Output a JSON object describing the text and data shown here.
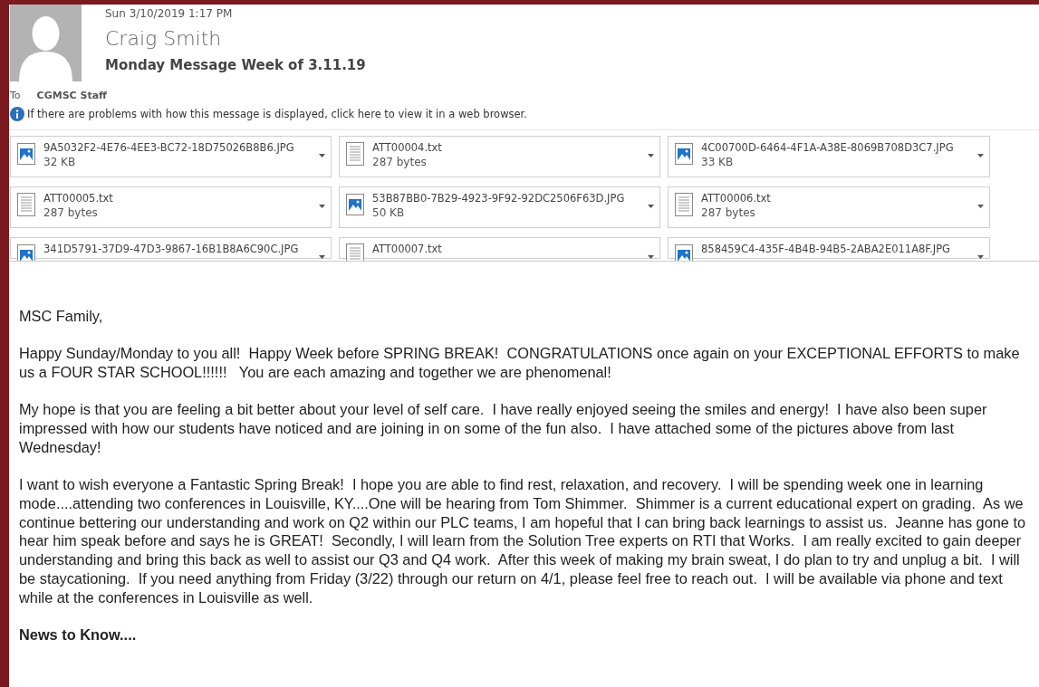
{
  "message": {
    "date": "Sun 3/10/2019 1:17 PM",
    "sender": "Craig Smith",
    "subject": "Monday Message Week of 3.11.19",
    "to_label": "To",
    "to": "CGMSC Staff",
    "info": "If there are problems with how this message is displayed, click here to view it in a web browser."
  },
  "attachments": [
    {
      "kind": "image",
      "name": "9A5032F2-4E76-4EE3-BC72-18D75026B8B6.JPG",
      "size": "32 KB"
    },
    {
      "kind": "text",
      "name": "ATT00004.txt",
      "size": "287 bytes"
    },
    {
      "kind": "image",
      "name": "4C00700D-6464-4F1A-A38E-8069B708D3C7.JPG",
      "size": "33 KB"
    },
    {
      "kind": "text",
      "name": "ATT00005.txt",
      "size": "287 bytes"
    },
    {
      "kind": "image",
      "name": "53B87BB0-7B29-4923-9F92-92DC2506F63D.JPG",
      "size": "50 KB"
    },
    {
      "kind": "text",
      "name": "ATT00006.txt",
      "size": "287 bytes"
    },
    {
      "kind": "image",
      "name": "341D5791-37D9-47D3-9867-16B1B8A6C90C.JPG"
    },
    {
      "kind": "text",
      "name": "ATT00007.txt"
    },
    {
      "kind": "image",
      "name": "858459C4-435F-4B4B-94B5-2ABA2E011A8F.JPG"
    }
  ],
  "body": [
    {
      "kind": "text",
      "text": "MSC Family,"
    },
    {
      "kind": "text",
      "text": "Happy Sunday/Monday to you all!  Happy Week before SPRING BREAK!  CONGRATULATIONS once again on your EXCEPTIONAL EFFORTS to make us a FOUR STAR SCHOOL!!!!!!   You are each amazing and together we are phenomenal!"
    },
    {
      "kind": "text",
      "text": "My hope is that you are feeling a bit better about your level of self care.  I have really enjoyed seeing the smiles and energy!  I have also been super impressed with how our students have noticed and are joining in on some of the fun also.  I have attached some of the pictures above from last Wednesday!"
    },
    {
      "kind": "text",
      "text": "I want to wish everyone a Fantastic Spring Break!  I hope you are able to find rest, relaxation, and recovery.  I will be spending week one in learning mode....attending two conferences in Louisville, KY....One will be hearing from Tom Shimmer.  Shimmer is a current educational expert on grading.  As we continue bettering our understanding and work on Q2 within our PLC teams, I am hopeful that I can bring back learnings to assist us.  Jeanne has gone to hear him speak before and says he is GREAT!  Secondly, I will learn from the Solution Tree experts on RTI that Works.  I am really excited to gain deeper understanding and bring this back as well to assist our Q3 and Q4 work.  After this week of making my brain sweat, I do plan to try and unplug a bit.  I will be staycationing.  If you need anything from Friday (3/22) through our return on 4/1, please feel free to reach out.  I will be available via phone and text while at the conferences in Louisville as well."
    },
    {
      "kind": "heading",
      "text": "News to Know...."
    }
  ]
}
